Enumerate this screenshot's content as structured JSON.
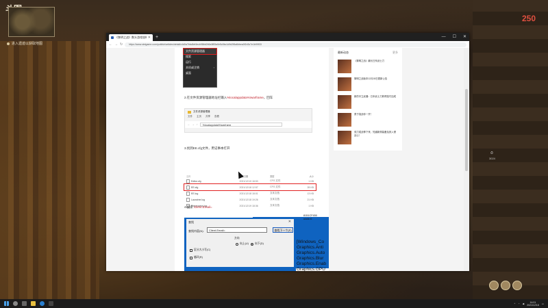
{
  "game": {
    "title": "斗图",
    "hint": "进入遗迹以获取地图",
    "ammo": "250",
    "timer_icon": "⏱",
    "timer_text": "3024"
  },
  "browser": {
    "tab_title": "《黎明之战》数头游戏攻略",
    "url": "https://www.steigame.com/publish/articles/detail/c4d0a7bbc8ef4ecb98bb2b5a3f83a0e5c5bc1d9d2f8a6bbea0f2d3c7e1b99f33"
  },
  "article": {
    "context_menu": [
      {
        "label": "文件资源管理器",
        "highlighted": true,
        "submenu": false
      },
      {
        "label": "搜索",
        "highlighted": false,
        "submenu": false
      },
      {
        "label": "运行",
        "highlighted": false,
        "submenu": false
      },
      {
        "label": "关机或注销",
        "highlighted": false,
        "submenu": true
      },
      {
        "label": "桌面",
        "highlighted": false,
        "submenu": false
      }
    ],
    "step2_prefix": "2.在文件资源管理器地址栏输入",
    "step2_path": "%localappdata%\\warframe",
    "step2_suffix": "，回车",
    "explorer_title": "文件资源管理器",
    "explorer_ribbon": [
      "文件",
      "主页",
      "共享",
      "查看"
    ],
    "explorer_path": "%localappdata%\\warframe",
    "step3": "3.找到EE.cfg文件，用记事本打开",
    "files_header": [
      "名称",
      "修改日期",
      "类型",
      "大小"
    ],
    "files": [
      {
        "name": "Editor.cfg",
        "date": "2021/12/19 18:53",
        "type": "CFG 文件",
        "size": "1 KB",
        "highlighted": false
      },
      {
        "name": "EE.cfg",
        "date": "2021/12/18 12:57",
        "type": "CFG 文件",
        "size": "28 KB",
        "highlighted": true
      },
      {
        "name": "EE.log",
        "date": "2021/12/18 18:01",
        "type": "文本文档",
        "size": "13 KB",
        "highlighted": false
      },
      {
        "name": "Launcher.log",
        "date": "2021/12/18 19:26",
        "type": "文本文档",
        "size": "21 KB",
        "highlighted": false
      },
      {
        "name": "Preprocess.log",
        "date": "2021/12/19 18:36",
        "type": "文本文档",
        "size": "1 KB",
        "highlighted": false
      }
    ],
    "step4_prefix": "4.搜索 ",
    "step4_term": "Client.Email=",
    "dialog": {
      "title": "查找",
      "close": "✕",
      "find_label": "查找内容(N):",
      "find_value": "Client.Email=",
      "find_next": "查找下一个(F)",
      "direction": "方向",
      "up": "向上(U)",
      "down": "向下(D)",
      "match_case": "区分大小写(C)",
      "wrap": "循环(R)"
    },
    "code_top": [
      "8151CF450",
      "ulold=0"
    ],
    "code_lines": [
      "[Windows_Co",
      "Graphics.Anti",
      "Graphics.Auto",
      "Graphics.Blur",
      "Graphics.Enab",
      "Graphics.GPU"
    ]
  },
  "sidebar": {
    "title": "最新动态",
    "more": "更多",
    "news": [
      {
        "title": "《黎明之战》最长日系武士刀 "
      },
      {
        "title": "黎明之战版本12月18日更新公告"
      },
      {
        "title": "新的中立武器：日本武士刀获得技巧加成"
      },
      {
        "title": "勇于挑战你一开！"
      },
      {
        "title": "双刀或战神下来，知道新规装备及其入侵战士！"
      }
    ]
  },
  "taskbar": {
    "time": "14:01",
    "date": "2021/12/18"
  }
}
